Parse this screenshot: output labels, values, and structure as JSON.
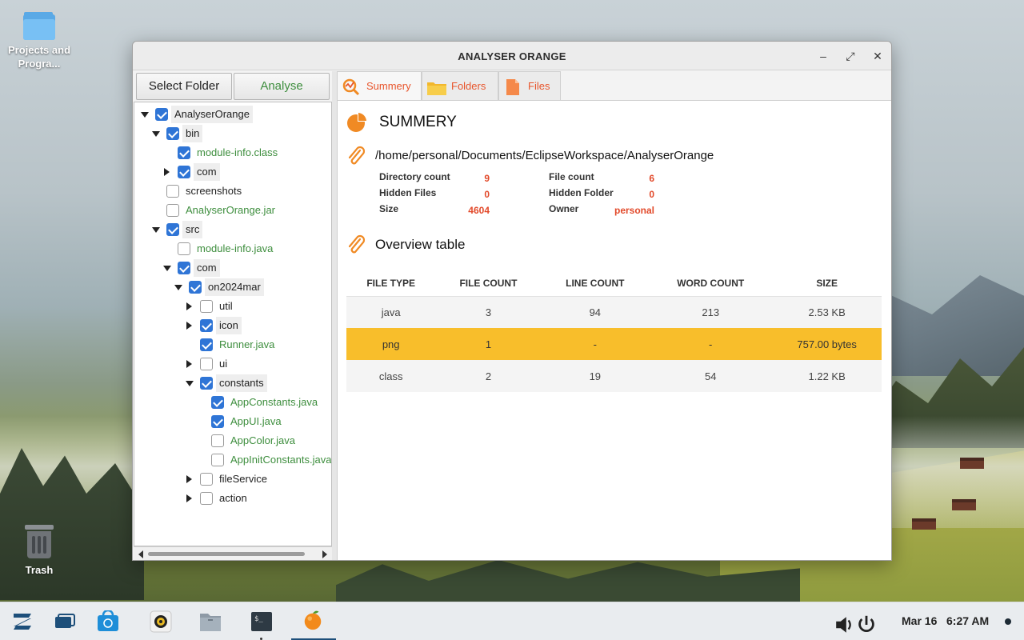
{
  "desktop": {
    "folder_label": "Projects and Progra...",
    "trash_label": "Trash"
  },
  "window": {
    "title": "ANALYSER ORANGE",
    "controls": {
      "minimize": "–",
      "maximize": "⤢",
      "close": "✕"
    }
  },
  "toolbar": {
    "select_folder": "Select Folder",
    "analyse": "Analyse"
  },
  "tree": [
    {
      "label": "AnalyserOrange",
      "checked": true,
      "expand": "down",
      "kind": "folder"
    },
    {
      "label": "bin",
      "checked": true,
      "expand": "down",
      "kind": "folder"
    },
    {
      "label": "module-info.class",
      "checked": true,
      "expand": "none",
      "kind": "file"
    },
    {
      "label": "com",
      "checked": true,
      "expand": "right",
      "kind": "folder"
    },
    {
      "label": "screenshots",
      "checked": false,
      "expand": "none",
      "kind": "plainfolder"
    },
    {
      "label": "AnalyserOrange.jar",
      "checked": false,
      "expand": "none",
      "kind": "file"
    },
    {
      "label": "src",
      "checked": true,
      "expand": "down",
      "kind": "folder"
    },
    {
      "label": "module-info.java",
      "checked": false,
      "expand": "none",
      "kind": "file"
    },
    {
      "label": "com",
      "checked": true,
      "expand": "down",
      "kind": "folder"
    },
    {
      "label": "on2024mar",
      "checked": true,
      "expand": "down",
      "kind": "folder"
    },
    {
      "label": "util",
      "checked": false,
      "expand": "right",
      "kind": "plainfolder"
    },
    {
      "label": "icon",
      "checked": true,
      "expand": "right",
      "kind": "folder"
    },
    {
      "label": "Runner.java",
      "checked": true,
      "expand": "none",
      "kind": "file"
    },
    {
      "label": "ui",
      "checked": false,
      "expand": "right",
      "kind": "plainfolder"
    },
    {
      "label": "constants",
      "checked": true,
      "expand": "down",
      "kind": "folder"
    },
    {
      "label": "AppConstants.java",
      "checked": true,
      "expand": "none",
      "kind": "file"
    },
    {
      "label": "AppUI.java",
      "checked": true,
      "expand": "none",
      "kind": "file"
    },
    {
      "label": "AppColor.java",
      "checked": false,
      "expand": "none",
      "kind": "file"
    },
    {
      "label": "AppInitConstants.java",
      "checked": false,
      "expand": "none",
      "kind": "file"
    },
    {
      "label": "fileService",
      "checked": false,
      "expand": "right",
      "kind": "plainfolder"
    },
    {
      "label": "action",
      "checked": false,
      "expand": "right",
      "kind": "plainfolder"
    }
  ],
  "tabs": [
    {
      "label": "Summery",
      "icon": "magnifier-chart-icon"
    },
    {
      "label": "Folders",
      "icon": "folder-icon"
    },
    {
      "label": "Files",
      "icon": "file-icon"
    }
  ],
  "summary": {
    "heading": "SUMMERY",
    "path": "/home/personal/Documents/EclipseWorkspace/AnalyserOrange",
    "stats_left": [
      {
        "key": "Directory count",
        "value": "9"
      },
      {
        "key": "Hidden Files",
        "value": "0"
      },
      {
        "key": "Size",
        "value": "4604"
      }
    ],
    "stats_right": [
      {
        "key": "File count",
        "value": "6"
      },
      {
        "key": "Hidden Folder",
        "value": "0"
      },
      {
        "key": "Owner",
        "value": "personal"
      }
    ],
    "overview_heading": "Overview table",
    "table": {
      "headers": [
        "FILE TYPE",
        "FILE COUNT",
        "LINE COUNT",
        "WORD COUNT",
        "SIZE"
      ],
      "rows": [
        [
          "java",
          "3",
          "94",
          "213",
          "2.53 KB"
        ],
        [
          "png",
          "1",
          "-",
          "-",
          "757.00 bytes"
        ],
        [
          "class",
          "2",
          "19",
          "54",
          "1.22 KB"
        ]
      ],
      "highlight_row": 1
    }
  },
  "taskbar": {
    "date": "Mar 16",
    "time": "6:27 AM"
  },
  "colors": {
    "accent_orange": "#e8552c",
    "highlight_row": "#f8be2b",
    "file_green": "#3e8e3e",
    "checkbox_blue": "#2f75d6"
  }
}
